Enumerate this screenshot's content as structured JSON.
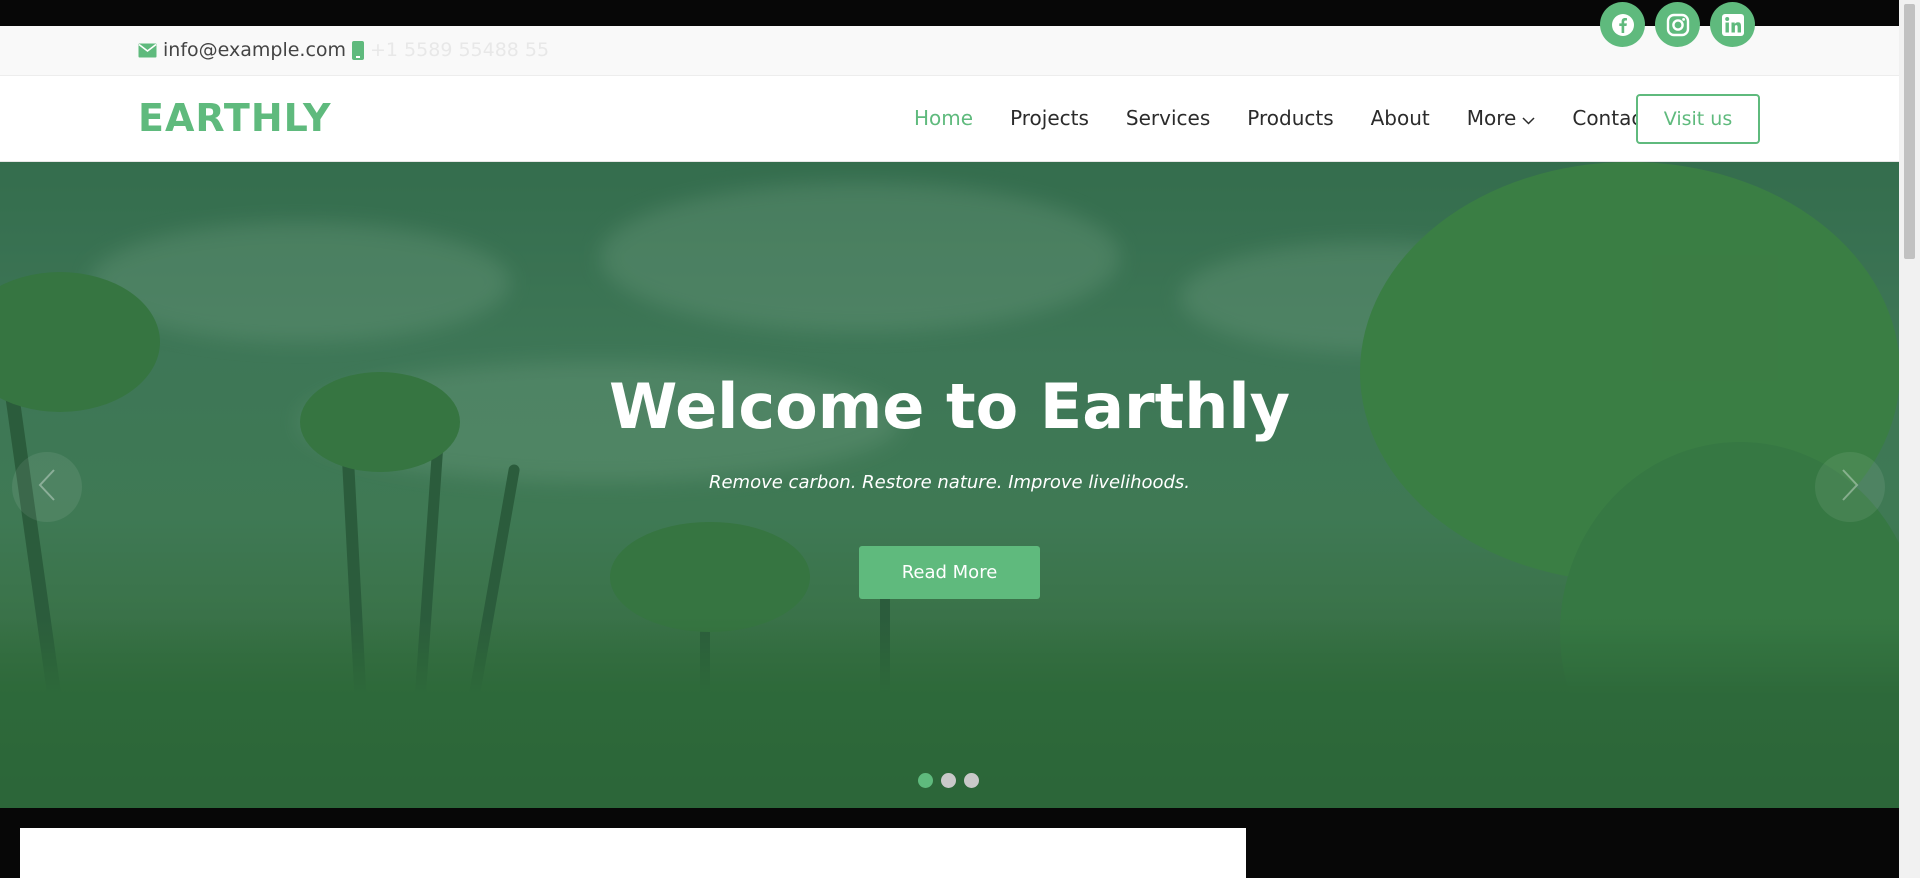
{
  "topbar": {
    "email": "info@example.com",
    "phone": "+1 5589 55488 55",
    "email_icon": "envelope-icon",
    "phone_icon": "phone-icon",
    "socials": [
      {
        "name": "facebook-icon"
      },
      {
        "name": "instagram-icon"
      },
      {
        "name": "linkedin-icon"
      }
    ]
  },
  "header": {
    "logo": "EARTHLY",
    "nav": [
      "Home",
      "Projects",
      "Services",
      "Products",
      "About",
      "More",
      "Contact"
    ],
    "active_nav": "Home",
    "visit_label": "Visit us"
  },
  "hero": {
    "title": "Welcome to Earthly",
    "subtitle": "Remove carbon. Restore nature. Improve livelihoods.",
    "cta_label": "Read More",
    "slide_count": 3,
    "active_slide": 1
  },
  "colors": {
    "accent": "#5fba7d",
    "text": "#2b2b2b"
  }
}
